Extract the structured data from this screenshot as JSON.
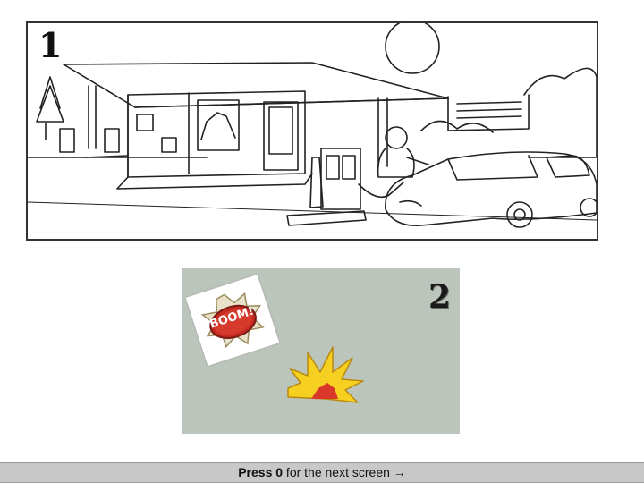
{
  "panel1": {
    "number": "1",
    "scene": "gas-station-sketch"
  },
  "panel2": {
    "number": "2",
    "sticker_text": "BOOM!"
  },
  "footer": {
    "key_label": "Press 0",
    "rest": " for the next screen ",
    "arrow": "→"
  },
  "colors": {
    "panel2_bg": "#bcc5bc",
    "footer_bg": "#c8c8c8",
    "explosion_yellow": "#f5d020",
    "explosion_red": "#d9382a"
  }
}
